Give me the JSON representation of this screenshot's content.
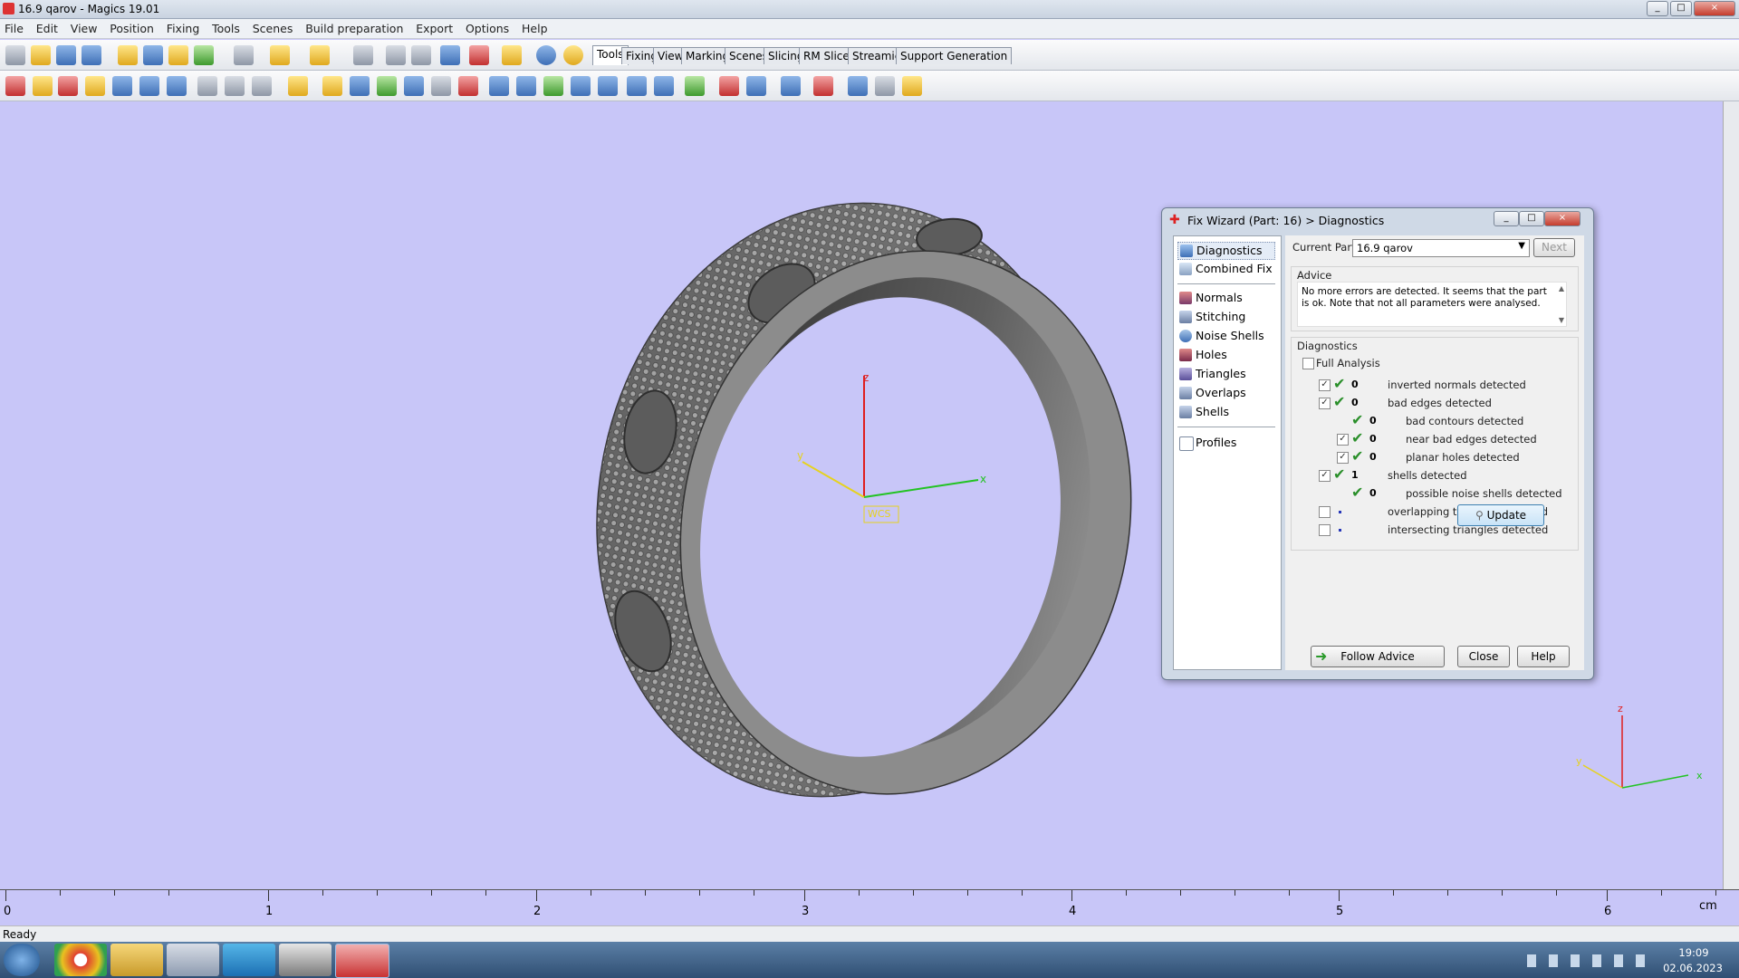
{
  "window": {
    "title": "16.9 qarov - Magics 19.01",
    "controls": [
      "_",
      "□",
      "×"
    ]
  },
  "menu": [
    "File",
    "Edit",
    "View",
    "Position",
    "Fixing",
    "Tools",
    "Scenes",
    "Build preparation",
    "Export",
    "Options",
    "Help"
  ],
  "ribbon_tabs": [
    "Tools",
    "Fixing",
    "View",
    "Marking",
    "Scenes",
    "Slicing",
    "RM Slicer",
    "Streamics",
    "Support Generation"
  ],
  "active_tab": "Tools",
  "viewport": {
    "axis_labels": {
      "z": "z",
      "y": "y",
      "x": "x",
      "wcs": "WCS"
    },
    "ruler_labels": [
      "0",
      "1",
      "2",
      "3",
      "4",
      "5",
      "6"
    ],
    "ruler_unit": "cm"
  },
  "status": "Ready",
  "dialog": {
    "title": "Fix Wizard (Part: 16) > Diagnostics",
    "nav_group1": [
      "Diagnostics",
      "Combined Fix"
    ],
    "nav_group2": [
      "Normals",
      "Stitching",
      "Noise Shells",
      "Holes",
      "Triangles",
      "Overlaps",
      "Shells"
    ],
    "nav_group3": [
      "Profiles"
    ],
    "current_part_label": "Current Part:",
    "current_part_value": "16.9 qarov",
    "next_label": "Next",
    "advice_title": "Advice",
    "advice_text": "No more errors are detected. It seems that the part is ok. Note that not all parameters were analysed.",
    "diagnostics_title": "Diagnostics",
    "full_analysis_label": "Full Analysis",
    "full_analysis_checked": false,
    "rows": [
      {
        "checked": true,
        "status": "ok",
        "count": "0",
        "label": "inverted normals detected",
        "indent": 0
      },
      {
        "checked": true,
        "status": "ok",
        "count": "0",
        "label": "bad edges detected",
        "indent": 0
      },
      {
        "checked": null,
        "status": "ok",
        "count": "0",
        "label": "bad contours detected",
        "indent": 1
      },
      {
        "checked": true,
        "status": "ok",
        "count": "0",
        "label": "near bad edges detected",
        "indent": 1
      },
      {
        "checked": true,
        "status": "ok",
        "count": "0",
        "label": "planar holes detected",
        "indent": 1
      },
      {
        "checked": true,
        "status": "ok",
        "count": "1",
        "label": "shells detected",
        "indent": 0
      },
      {
        "checked": null,
        "status": "ok",
        "count": "0",
        "label": "possible noise shells detected",
        "indent": 1
      },
      {
        "checked": false,
        "status": "dot",
        "count": "",
        "label": "overlapping triangles detected",
        "indent": 0
      },
      {
        "checked": false,
        "status": "dot",
        "count": "",
        "label": "intersecting triangles detected",
        "indent": 0
      }
    ],
    "update_label": "Update",
    "follow_advice_label": "Follow Advice",
    "close_label": "Close",
    "help_label": "Help"
  },
  "taskbar": {
    "clock_time": "19:09",
    "clock_date": "02.06.2023"
  },
  "colors": {
    "viewport_bg": "#c8c6f8",
    "part_gray": "#8c8c8c",
    "axis_x": "#22c322",
    "axis_y": "#e6d21e",
    "axis_z": "#e01e1e",
    "ok_green": "#2a8f2a"
  }
}
